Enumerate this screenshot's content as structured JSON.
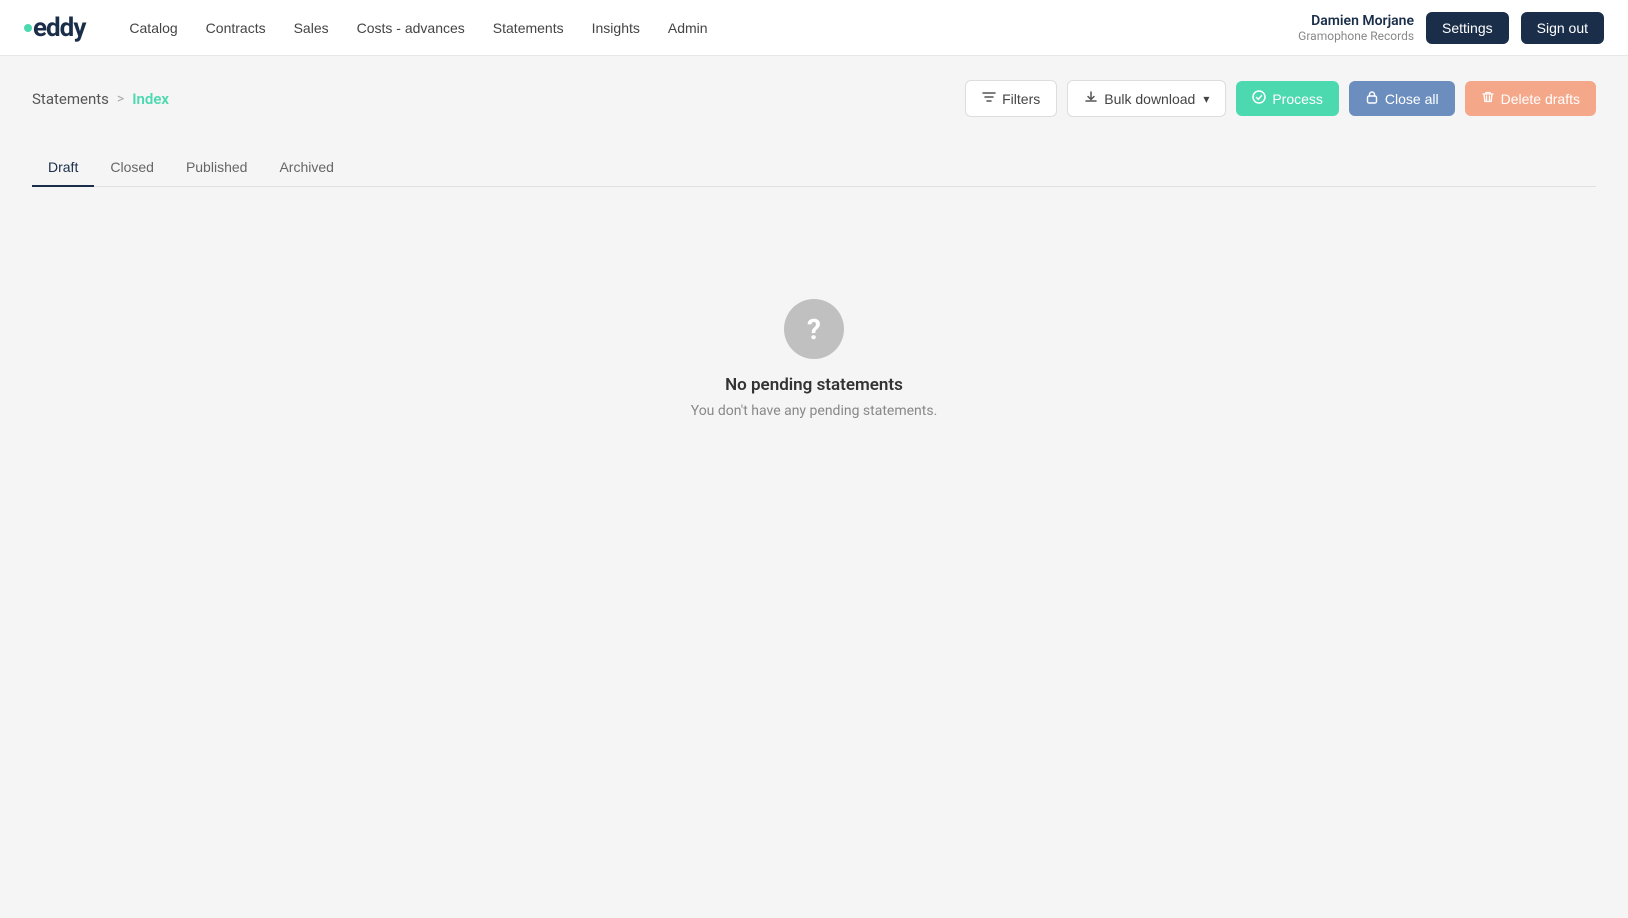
{
  "logo": {
    "text": "eddy"
  },
  "nav": {
    "links": [
      {
        "label": "Catalog",
        "id": "catalog"
      },
      {
        "label": "Contracts",
        "id": "contracts"
      },
      {
        "label": "Sales",
        "id": "sales"
      },
      {
        "label": "Costs - advances",
        "id": "costs-advances"
      },
      {
        "label": "Statements",
        "id": "statements"
      },
      {
        "label": "Insights",
        "id": "insights"
      },
      {
        "label": "Admin",
        "id": "admin"
      }
    ]
  },
  "user": {
    "name": "Damien Morjane",
    "company": "Gramophone Records"
  },
  "header": {
    "settings_label": "Settings",
    "signout_label": "Sign out"
  },
  "breadcrumb": {
    "parent": "Statements",
    "separator": ">",
    "current": "Index"
  },
  "actions": {
    "filters_label": "Filters",
    "bulk_download_label": "Bulk download",
    "process_label": "Process",
    "close_all_label": "Close all",
    "delete_drafts_label": "Delete drafts"
  },
  "tabs": [
    {
      "label": "Draft",
      "id": "draft",
      "active": true
    },
    {
      "label": "Closed",
      "id": "closed",
      "active": false
    },
    {
      "label": "Published",
      "id": "published",
      "active": false
    },
    {
      "label": "Archived",
      "id": "archived",
      "active": false
    }
  ],
  "empty_state": {
    "title": "No pending statements",
    "subtitle": "You don't have any pending statements."
  }
}
